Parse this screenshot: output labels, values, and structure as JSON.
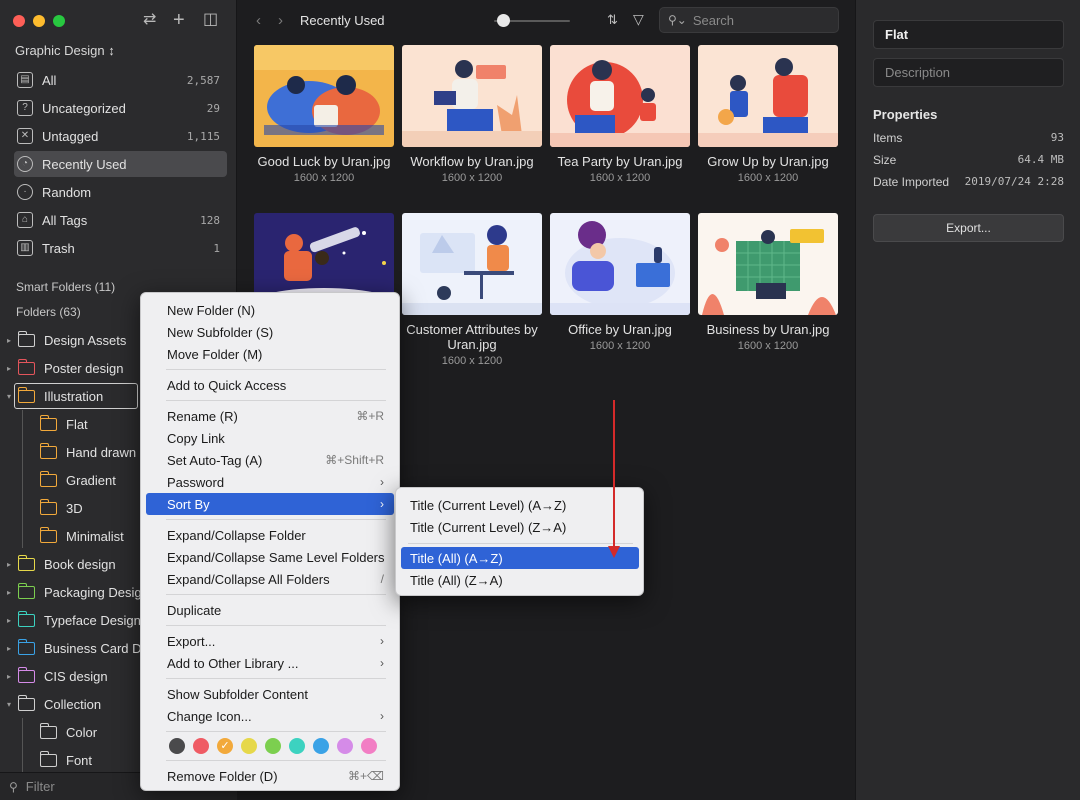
{
  "window": {
    "traffic_colors": [
      "#fe5f57",
      "#febc2e",
      "#28c840"
    ]
  },
  "sidebar": {
    "library_title": "Graphic Design ↕",
    "items": [
      {
        "label": "All",
        "count": "2,587",
        "icon": "all-icon"
      },
      {
        "label": "Uncategorized",
        "count": "29",
        "icon": "uncategorized-icon"
      },
      {
        "label": "Untagged",
        "count": "1,115",
        "icon": "untagged-icon"
      },
      {
        "label": "Recently Used",
        "count": "",
        "icon": "clock-icon"
      },
      {
        "label": "Random",
        "count": "",
        "icon": "lightbulb-icon"
      },
      {
        "label": "All Tags",
        "count": "128",
        "icon": "tag-icon"
      },
      {
        "label": "Trash",
        "count": "1",
        "icon": "trash-icon"
      }
    ],
    "smart_folders": "Smart Folders (11)",
    "folders_title": "Folders (63)",
    "folders": [
      {
        "label": "Design Assets",
        "color": "#cfcfcf"
      },
      {
        "label": "Poster design",
        "color": "#e4555c"
      },
      {
        "label": "Illustration",
        "color": "#f2a93b"
      },
      {
        "label": "Flat",
        "color": "#f2a93b"
      },
      {
        "label": "Hand drawn",
        "color": "#f2a93b"
      },
      {
        "label": "Gradient",
        "color": "#f2a93b"
      },
      {
        "label": "3D",
        "color": "#f2a93b"
      },
      {
        "label": "Minimalist",
        "color": "#f2a93b"
      },
      {
        "label": "Book design",
        "color": "#e6d84a"
      },
      {
        "label": "Packaging Design",
        "color": "#7ccf4f"
      },
      {
        "label": "Typeface Design",
        "color": "#3cd2c0"
      },
      {
        "label": "Business Card Design",
        "color": "#3aa2e6"
      },
      {
        "label": "CIS design",
        "color": "#d58be8"
      },
      {
        "label": "Collection",
        "color": "#cfcfcf"
      },
      {
        "label": "Color",
        "color": "#cfcfcf"
      },
      {
        "label": "Font",
        "color": "#cfcfcf"
      }
    ],
    "filter_placeholder": "Filter"
  },
  "toolbar": {
    "back": "‹",
    "forward": "›",
    "title": "Recently Used",
    "search_placeholder": "Search"
  },
  "grid": [
    {
      "name": "Good Luck by Uran.jpg",
      "dim": "1600 x 1200"
    },
    {
      "name": "Workflow by Uran.jpg",
      "dim": "1600 x 1200"
    },
    {
      "name": "Tea Party by Uran.jpg",
      "dim": "1600 x 1200"
    },
    {
      "name": "Grow Up by Uran.jpg",
      "dim": "1600 x 1200"
    },
    {
      "name": "",
      "dim": ""
    },
    {
      "name": "Customer Attributes by Uran.jpg",
      "dim": "1600 x 1200"
    },
    {
      "name": "Office by Uran.jpg",
      "dim": "1600 x 1200"
    },
    {
      "name": "Business by Uran.jpg",
      "dim": "1600 x 1200"
    }
  ],
  "details": {
    "title_value": "Flat",
    "description_placeholder": "Description",
    "properties_title": "Properties",
    "props": [
      {
        "k": "Items",
        "v": "93"
      },
      {
        "k": "Size",
        "v": "64.4 MB"
      },
      {
        "k": "Date Imported",
        "v": "2019/07/24 2:28"
      }
    ],
    "export_label": "Export..."
  },
  "context_menu": {
    "items": [
      {
        "label": "New Folder (N)",
        "shortcut": "",
        "arrow": false
      },
      {
        "label": "New Subfolder (S)",
        "shortcut": "",
        "arrow": false
      },
      {
        "label": "Move Folder (M)",
        "shortcut": "",
        "arrow": false
      },
      {
        "label": "Add to Quick Access",
        "shortcut": "",
        "arrow": false
      },
      {
        "label": "Rename (R)",
        "shortcut": "⌘+R",
        "arrow": false
      },
      {
        "label": "Copy Link",
        "shortcut": "",
        "arrow": false
      },
      {
        "label": "Set Auto-Tag (A)",
        "shortcut": "⌘+Shift+R",
        "arrow": false
      },
      {
        "label": "Password",
        "shortcut": "",
        "arrow": true
      },
      {
        "label": "Sort By",
        "shortcut": "",
        "arrow": true
      },
      {
        "label": "Expand/Collapse Folder",
        "shortcut": "",
        "arrow": false
      },
      {
        "label": "Expand/Collapse Same Level Folders",
        "shortcut": "",
        "arrow": false
      },
      {
        "label": "Expand/Collapse All Folders",
        "shortcut": "/",
        "arrow": false
      },
      {
        "label": "Duplicate",
        "shortcut": "",
        "arrow": false
      },
      {
        "label": "Export...",
        "shortcut": "",
        "arrow": true
      },
      {
        "label": "Add to Other Library ...",
        "shortcut": "",
        "arrow": true
      },
      {
        "label": "Show Subfolder Content",
        "shortcut": "",
        "arrow": false
      },
      {
        "label": "Change Icon...",
        "shortcut": "",
        "arrow": true
      },
      {
        "label": "Remove Folder (D)",
        "shortcut": "⌘+⌫",
        "arrow": false
      }
    ],
    "colors": [
      "#4a4a4c",
      "#ef5b64",
      "#f2a93b",
      "#e6d84a",
      "#7ccf4f",
      "#3cd2c0",
      "#3aa2e6",
      "#d58be8",
      "#f27ec4"
    ],
    "selected_color_check": "✓"
  },
  "sort_submenu": {
    "items": [
      "Title (Current Level) (A→Z)",
      "Title (Current Level) (Z→A)",
      "Title (All) (A→Z)",
      "Title (All) (Z→A)"
    ]
  }
}
